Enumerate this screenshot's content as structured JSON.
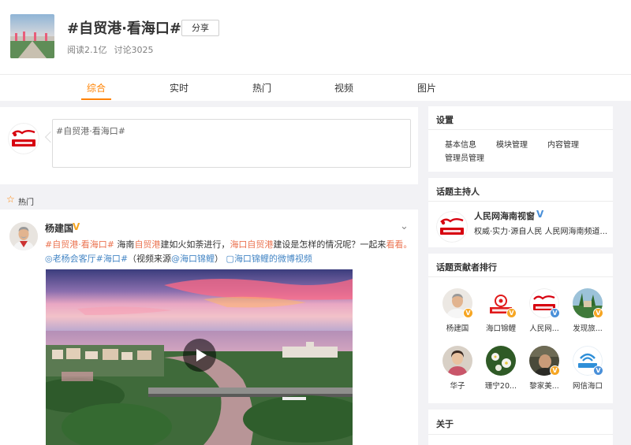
{
  "topic": {
    "title": "#自贸港·看海口#",
    "share_label": "分享",
    "reads": "阅读2.1亿",
    "discussions": "讨论3025"
  },
  "tabs": [
    {
      "label": "综合",
      "active": true
    },
    {
      "label": "实时",
      "active": false
    },
    {
      "label": "热门",
      "active": false
    },
    {
      "label": "视频",
      "active": false
    },
    {
      "label": "图片",
      "active": false
    }
  ],
  "compose": {
    "text": "#自贸港·看海口#",
    "avatar_icon": "people-daily-hainan-logo"
  },
  "hot_section": {
    "label": "热门",
    "icon": "star-outline-icon"
  },
  "post": {
    "author": "杨建国",
    "verified_badge": "V",
    "more_icon": "chevron-down-icon",
    "text_parts": {
      "p1": "#自贸港·看海口#",
      "p2": " 海南",
      "p3": "自贸港",
      "p4": "建如火如荼进行，",
      "p5": "海口自贸港",
      "p6": "建设是怎样的情况呢？一起来",
      "p7": "看看。",
      "p8": "老杨会客厅",
      "p9": "#海口#",
      "p10": "（视频来源",
      "p11": "@海口锦鲤",
      "p12": "）",
      "p13": "海口锦鲤的微博视频"
    }
  },
  "sidebar": {
    "settings": {
      "title": "设置",
      "links": [
        "基本信息",
        "模块管理",
        "内容管理",
        "管理员管理"
      ]
    },
    "host": {
      "title": "话题主持人",
      "name": "人民网海南视窗",
      "verified_badge": "V",
      "desc": "权威·实力·源自人民 人民网海南频道..."
    },
    "contributors": {
      "title": "话题贡献者排行",
      "items": [
        {
          "name": "杨建国",
          "badge": "V"
        },
        {
          "name": "海口锦鲤",
          "badge": "V"
        },
        {
          "name": "人民网...",
          "badge": "V"
        },
        {
          "name": "发现旅...",
          "badge": "V"
        },
        {
          "name": "华子",
          "badge": ""
        },
        {
          "name": "珊宁20...",
          "badge": ""
        },
        {
          "name": "黎家美...",
          "badge": "V"
        },
        {
          "name": "网信海口",
          "badge": "V"
        }
      ]
    },
    "about": {
      "title": "关于"
    }
  },
  "colors": {
    "accent": "#ff8200",
    "link": "#eb7350",
    "blue": "#4486c5",
    "verified_gold": "#f6a623",
    "verified_blue": "#4a90d9"
  }
}
